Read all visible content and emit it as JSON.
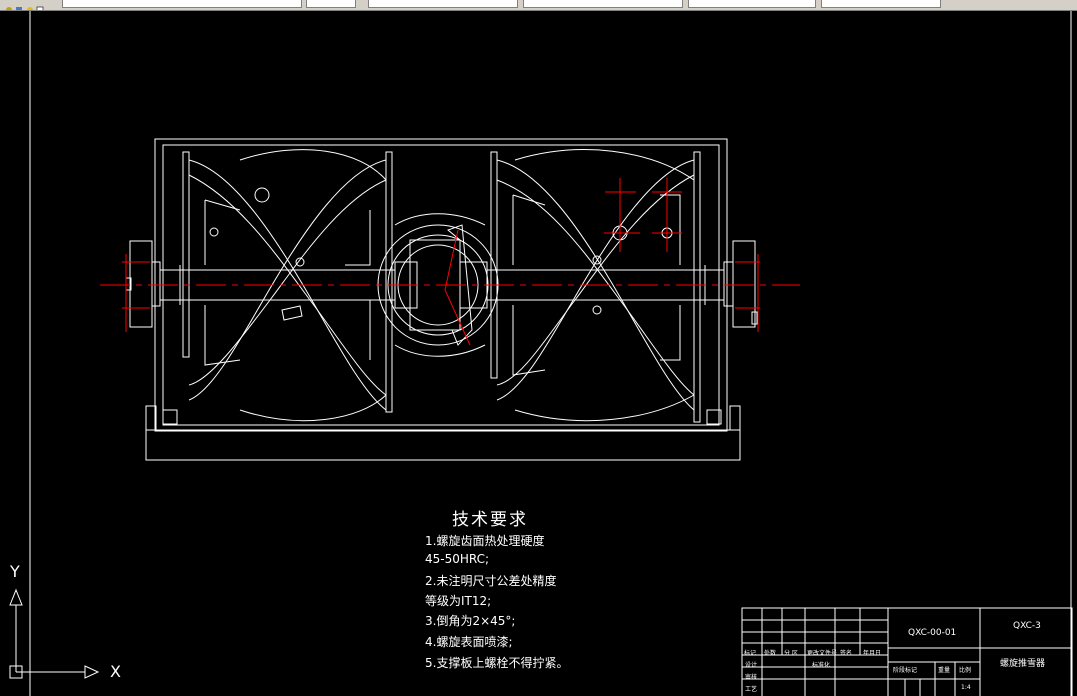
{
  "toolbar": {
    "layer_combo": "",
    "combo1": "",
    "combo2": "",
    "combo3": "",
    "combo4": ""
  },
  "tech": {
    "title": "技术要求",
    "lines": [
      "1.螺旋齿面热处理硬度",
      "45-50HRC;",
      "2.未注明尺寸公差处精度",
      "等级为IT12;",
      "3.倒角为2×45°;",
      "4.螺旋表面喷漆;",
      "5.支撑板上螺栓不得拧紧。"
    ]
  },
  "title_block": {
    "drawing_no": "QXC-00-01",
    "project_code": "QXC-3",
    "part_name": "螺旋推雪器",
    "scale": "1:4",
    "headers": [
      "标记",
      "处数",
      "分 区",
      "更改文件号",
      "签名",
      "年月日"
    ],
    "row_labels": [
      "设计",
      "审核",
      "工艺"
    ],
    "std_label": "标准化",
    "stage_label": "阶段标记",
    "weight_label": "重量",
    "scale_label": "比例"
  },
  "ucs": {
    "x_label": "X",
    "y_label": "Y"
  },
  "colors": {
    "background": "#000000",
    "lines": "#ffffff",
    "centerline": "#ff0000"
  }
}
